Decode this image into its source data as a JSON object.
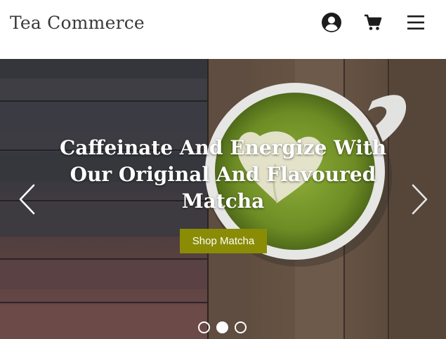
{
  "header": {
    "logo": "Tea Commerce",
    "icons": [
      "account-icon",
      "cart-icon",
      "menu-icon"
    ]
  },
  "hero": {
    "caption_lines": [
      "Caffeinate And Energize With",
      "Our Original And Flavoured",
      "Matcha"
    ],
    "button_label": "Shop Matcha",
    "slides": {
      "count": 3,
      "active": 2
    },
    "colors": {
      "button": "#8a8c06",
      "matcha": "#7a9a2a",
      "wood": "#5a4838"
    }
  }
}
